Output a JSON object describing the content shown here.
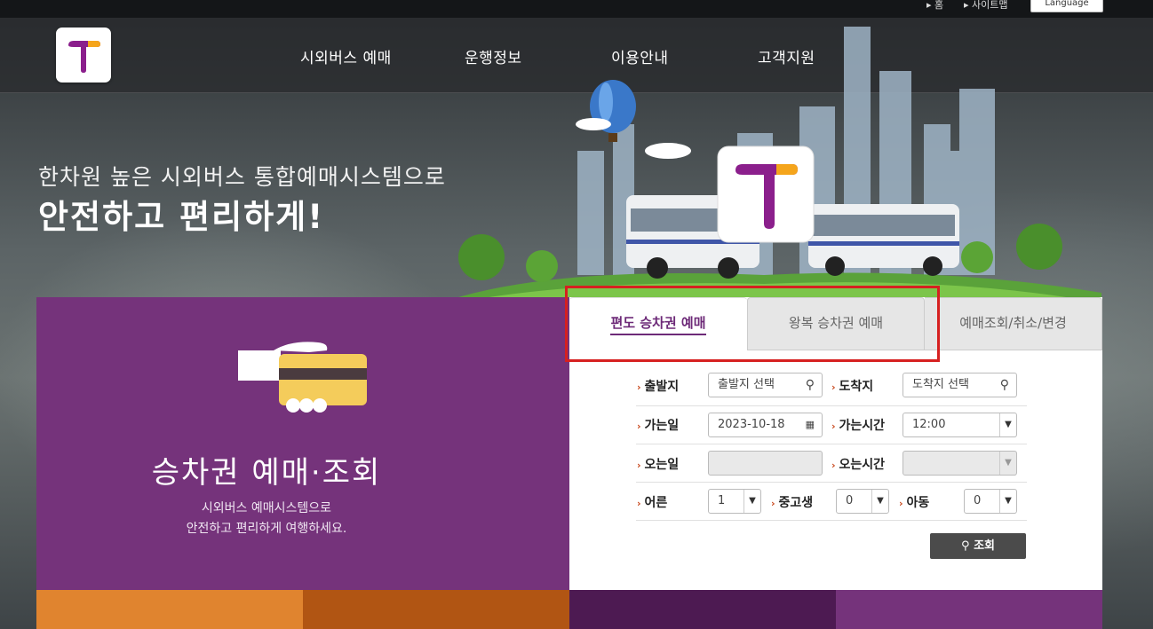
{
  "topbar": {
    "util_links": [
      "홈",
      "사이트맵"
    ],
    "language_button": "Language"
  },
  "header": {
    "nav": [
      "시외버스 예매",
      "운행정보",
      "이용안내",
      "고객지원"
    ]
  },
  "hero": {
    "line1": "한차원 높은 시외버스 통합예매시스템으로",
    "line2": "안전하고 편리하게!"
  },
  "left_panel": {
    "title": "승차권 예매·조회",
    "desc1": "시외버스 예매시스템으로",
    "desc2": "안전하고 편리하게 여행하세요."
  },
  "tabs": [
    "편도 승차권 예매",
    "왕복 승차권 예매",
    "예매조회/취소/변경"
  ],
  "form": {
    "departure": {
      "label": "출발지",
      "placeholder": "출발지 선택"
    },
    "arrival": {
      "label": "도착지",
      "placeholder": "도착지 선택"
    },
    "go_date": {
      "label": "가는일",
      "value": "2023-10-18"
    },
    "go_time": {
      "label": "가는시간",
      "value": "12:00"
    },
    "return_date": {
      "label": "오는일",
      "value": ""
    },
    "return_time": {
      "label": "오는시간",
      "value": ""
    },
    "adult": {
      "label": "어른",
      "value": "1"
    },
    "youth": {
      "label": "중고생",
      "value": "0"
    },
    "child": {
      "label": "아동",
      "value": "0"
    },
    "search_button": "조회"
  },
  "colors": {
    "brand_purple": "#75337b",
    "tile_orange": "#e0842f",
    "tile_dark_orange": "#b15513",
    "tile_dark_purple": "#4d1a52",
    "highlight_red": "#d62020"
  }
}
